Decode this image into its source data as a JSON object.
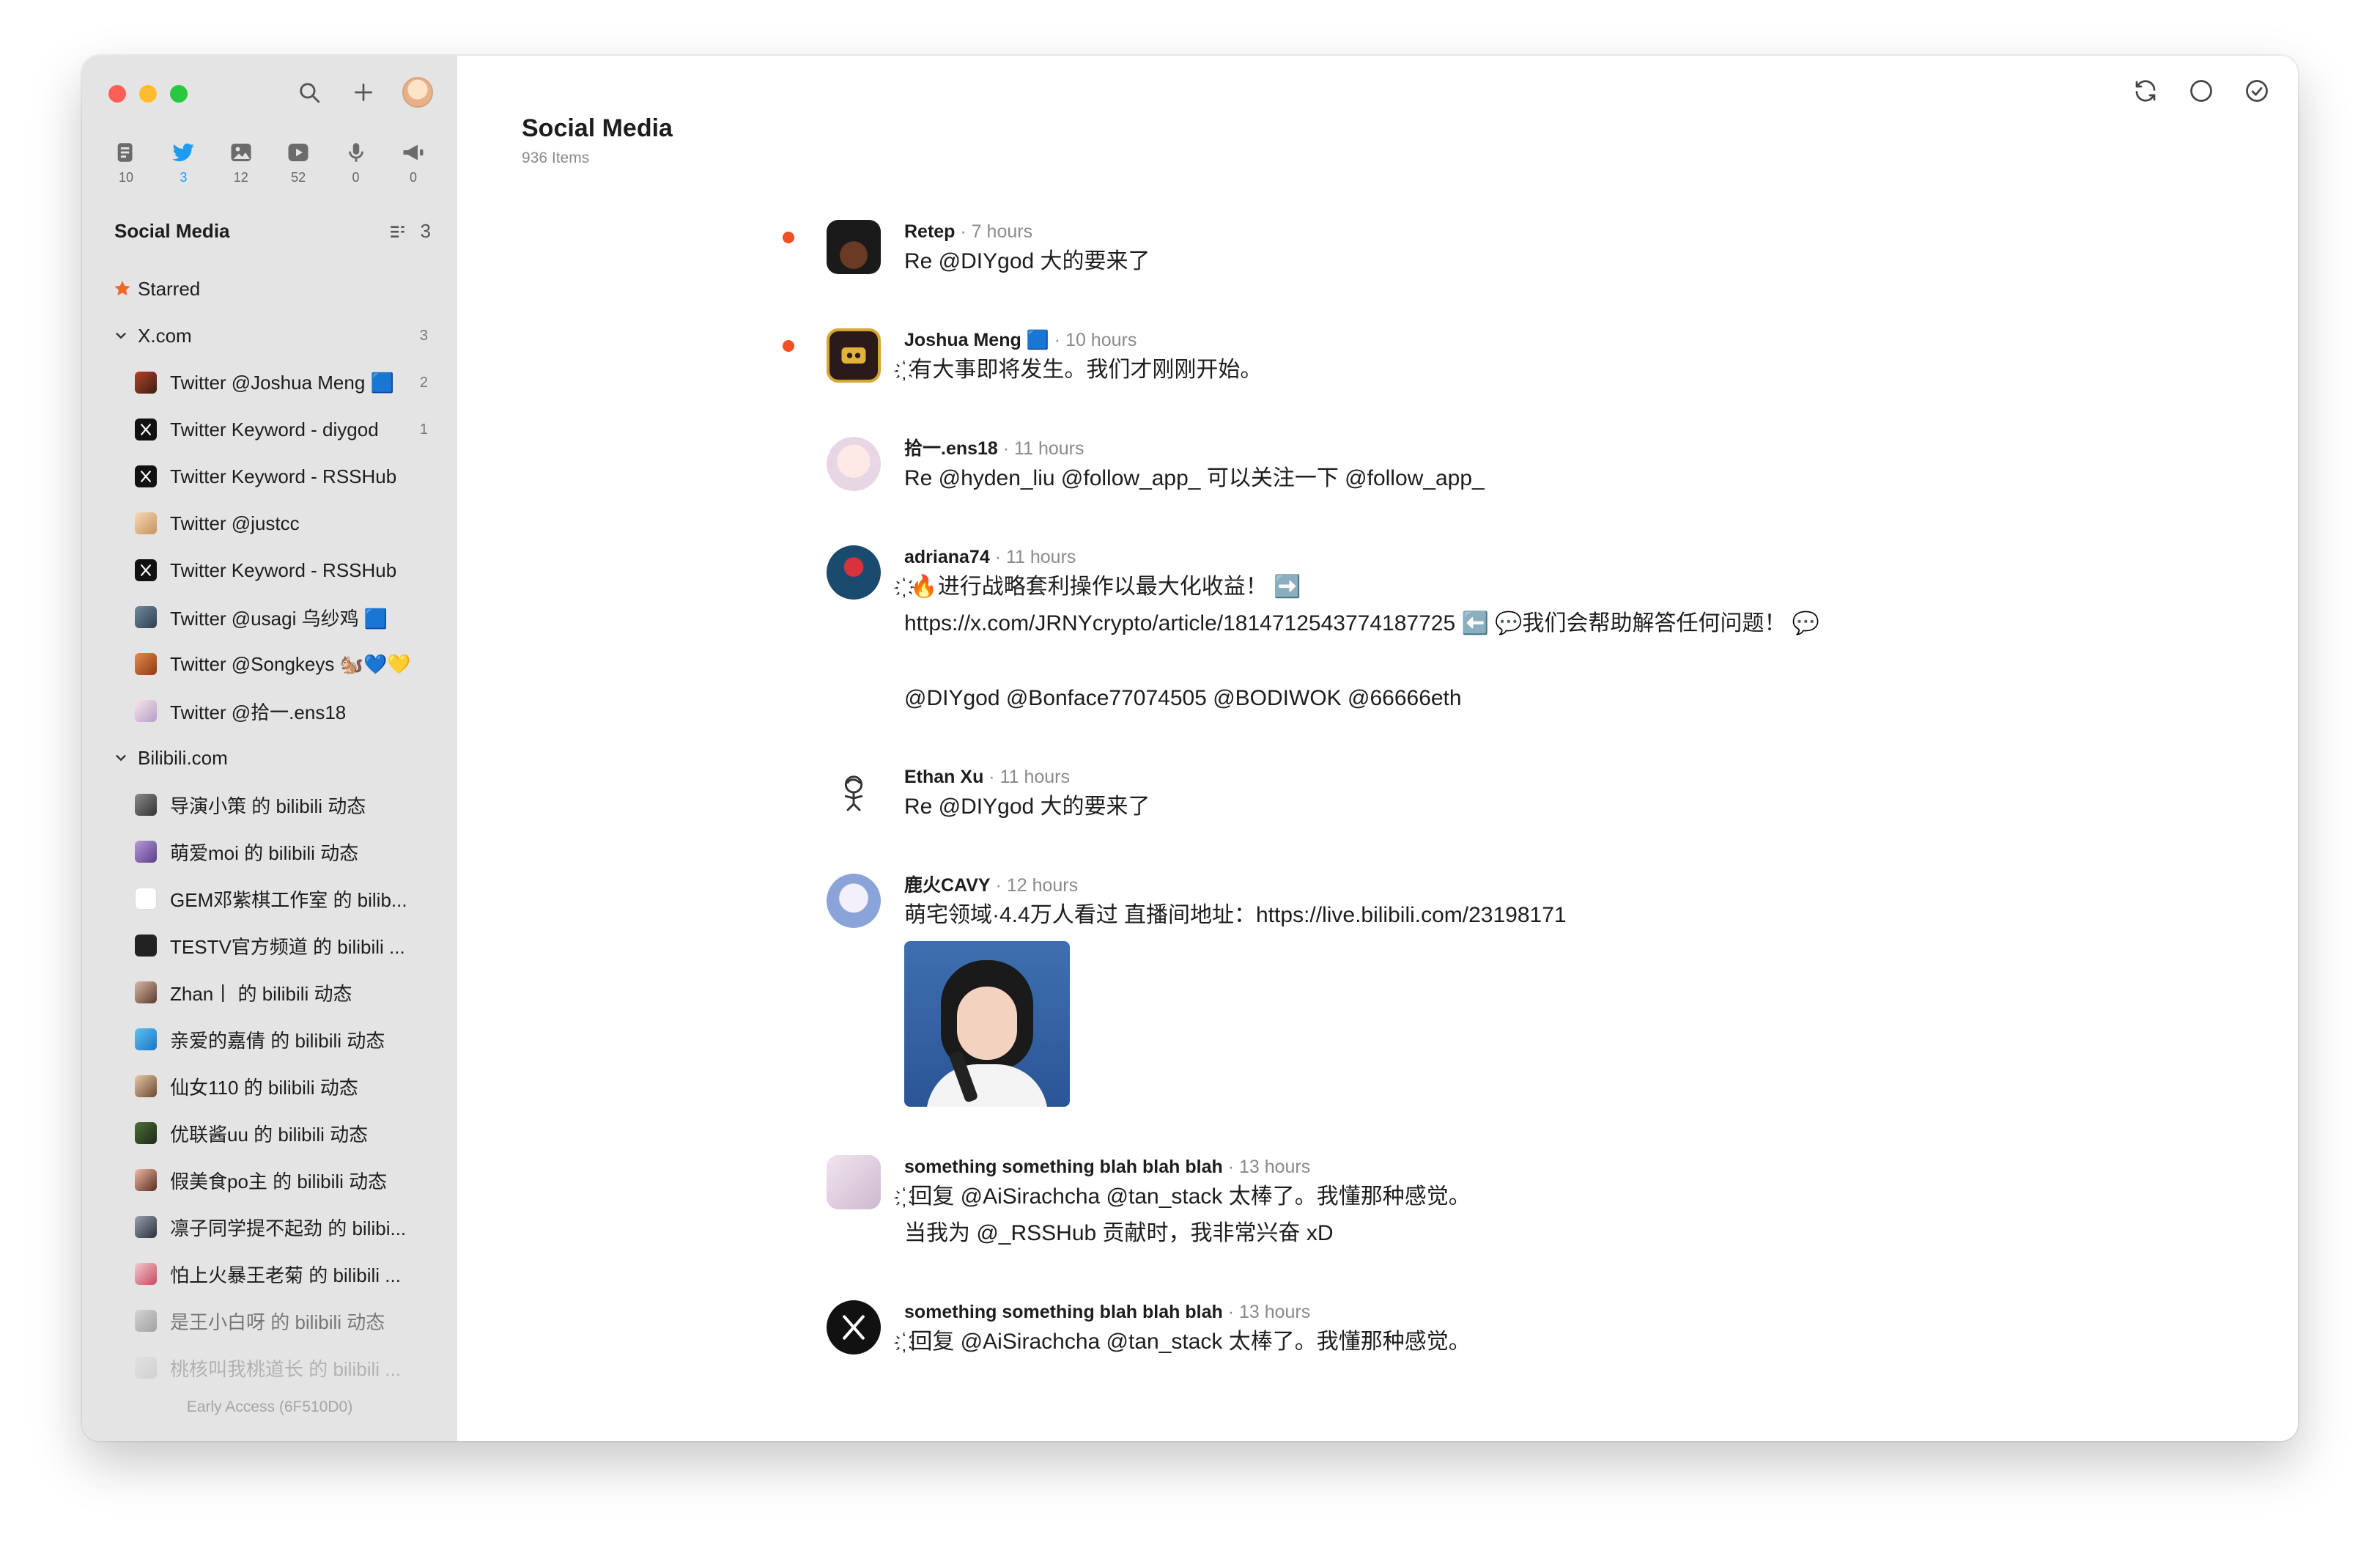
{
  "sidebar": {
    "views": [
      {
        "icon": "article-icon",
        "count": "10"
      },
      {
        "icon": "twitter-bird-icon",
        "count": "3"
      },
      {
        "icon": "picture-icon",
        "count": "12"
      },
      {
        "icon": "video-icon",
        "count": "52"
      },
      {
        "icon": "microphone-icon",
        "count": "0"
      },
      {
        "icon": "megaphone-icon",
        "count": "0"
      }
    ],
    "section_title": "Social Media",
    "section_count": "3",
    "starred_label": "Starred",
    "groups": [
      {
        "label": "X.com",
        "count": "3"
      },
      {
        "label": "Bilibili.com",
        "count": ""
      }
    ],
    "xcom_items": [
      {
        "label": "Twitter @Joshua Meng 🟦",
        "count": "2"
      },
      {
        "label": "Twitter Keyword - diygod",
        "count": "1"
      },
      {
        "label": "Twitter Keyword - RSSHub",
        "count": ""
      },
      {
        "label": "Twitter @justcc",
        "count": ""
      },
      {
        "label": "Twitter Keyword - RSSHub",
        "count": ""
      },
      {
        "label": "Twitter @usagi 乌纱鸡 🟦",
        "count": ""
      },
      {
        "label": "Twitter @Songkeys 🐿️💙💛",
        "count": ""
      },
      {
        "label": "Twitter @拾一.ens18",
        "count": ""
      }
    ],
    "bili_items": [
      {
        "label": "导演小策 的 bilibili 动态"
      },
      {
        "label": "萌爱moi 的 bilibili 动态"
      },
      {
        "label": "GEM邓紫棋工作室 的 bilib..."
      },
      {
        "label": "TESTV官方频道 的 bilibili ..."
      },
      {
        "label": "Zhan丨 的 bilibili 动态"
      },
      {
        "label": "亲爱的嘉倩 的 bilibili 动态"
      },
      {
        "label": "仙女110 的 bilibili 动态"
      },
      {
        "label": "优联酱uu 的 bilibili 动态"
      },
      {
        "label": "假美食po主 的 bilibili 动态"
      },
      {
        "label": "凛子同学提不起劲 的 bilibi..."
      },
      {
        "label": "怕上火暴王老菊 的 bilibili ..."
      },
      {
        "label": "是王小白呀 的 bilibili 动态"
      },
      {
        "label": "桃核叫我桃道长 的 bilibili ..."
      }
    ],
    "early_access": "Early Access (6F510D0)"
  },
  "main": {
    "title": "Social Media",
    "subtitle": "936 Items",
    "entries": [
      {
        "author": "Retep",
        "time": " · 7 hours",
        "unread": true,
        "lines": [
          "Re @DIYgod 大的要来了"
        ]
      },
      {
        "author": "Joshua Meng 🟦",
        "time": " · 10 hours",
        "unread": true,
        "lines": [
          "҉ 有大事即将发生。我们才刚刚开始。"
        ]
      },
      {
        "author": "拾一.ens18",
        "time": " · 11 hours",
        "unread": false,
        "lines": [
          "Re @hyden_liu @follow_app_ 可以关注一下 @follow_app_"
        ]
      },
      {
        "author": "adriana74",
        "time": " · 11 hours",
        "unread": false,
        "lines": [
          "҉ 🔥进行战略套利操作以最大化收益！ ➡️",
          "https://x.com/JRNYcrypto/article/1814712543774187725 ⬅️ 💬我们会帮助解答任何问题！ 💬",
          "",
          "@DIYgod @Bonface77074505 @BODIWOK @66666eth"
        ]
      },
      {
        "author": "Ethan Xu",
        "time": " · 11 hours",
        "unread": false,
        "lines": [
          "Re @DIYgod 大的要来了"
        ]
      },
      {
        "author": "鹿火CAVY",
        "time": " · 12 hours",
        "unread": false,
        "lines": [
          "萌宅领域·4.4万人看过 直播间地址：https://live.bilibili.com/23198171"
        ]
      },
      {
        "author": "something something blah blah blah",
        "time": " · 13 hours",
        "unread": false,
        "lines": [
          "҉ 回复 @AiSirachcha @tan_stack 太棒了。我懂那种感觉。",
          "当我为 @_RSSHub 贡献时，我非常兴奋 xD"
        ]
      },
      {
        "author": "something something blah blah blah",
        "time": " · 13 hours",
        "unread": false,
        "lines": [
          "҉ 回复 @AiSirachcha @tan_stack 太棒了。我懂那种感觉。"
        ]
      }
    ]
  },
  "colors": {
    "accent_unread": "#f04e23",
    "twitter_blue": "#1d9bf0",
    "starred": "#f26522",
    "sidebar_bg": "#e4e4e4"
  }
}
